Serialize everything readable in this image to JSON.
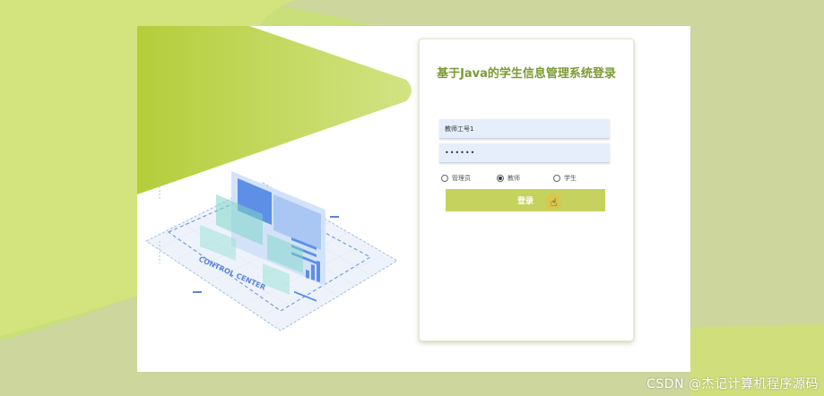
{
  "login": {
    "title": "基于Java的学生信息管理系统登录",
    "username_value": "教师工号1",
    "password_mask": "••••••",
    "roles": [
      "管理员",
      "教师",
      "学生"
    ],
    "selected_role": "教师",
    "submit_label": "登录"
  },
  "illustration": {
    "caption": "CONTROL CENTER"
  },
  "watermark": {
    "text": "CSDN @杰记计算机程序源码"
  },
  "colors": {
    "background": "#cdd69d",
    "accent_green": "#c5d25e",
    "title_green": "#7b9a33",
    "field_bg": "#e6eefb"
  }
}
